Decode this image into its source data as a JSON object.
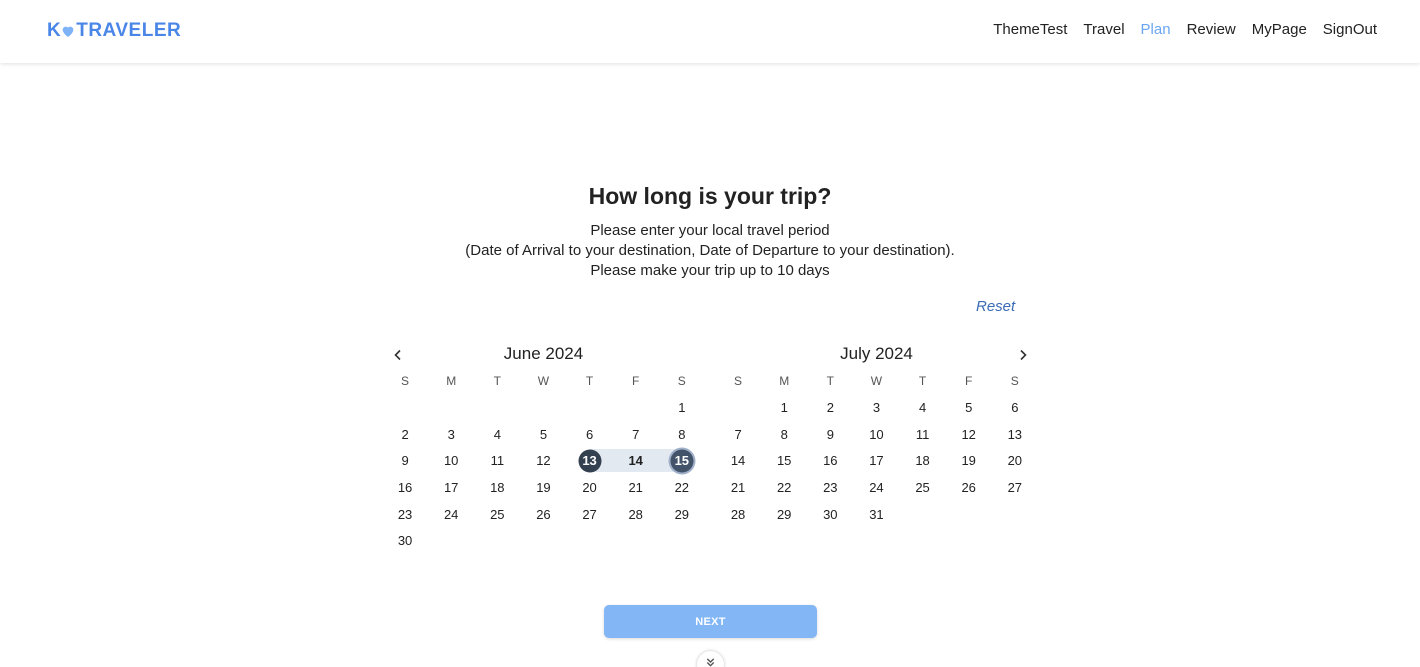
{
  "header": {
    "logo_prefix": "K",
    "logo_text": "TRAVELER",
    "nav": [
      {
        "label": "ThemeTest",
        "active": false
      },
      {
        "label": "Travel",
        "active": false
      },
      {
        "label": "Plan",
        "active": true
      },
      {
        "label": "Review",
        "active": false
      },
      {
        "label": "MyPage",
        "active": false
      },
      {
        "label": "SignOut",
        "active": false
      }
    ]
  },
  "main": {
    "title": "How long is your trip?",
    "description_lines": [
      "Please enter your local travel period",
      "(Date of Arrival to your destination, Date of Departure to your destination).",
      "Please make your trip up to 10 days"
    ],
    "reset_label": "Reset",
    "next_label": "NEXT"
  },
  "calendar": {
    "weekdays": [
      "S",
      "M",
      "T",
      "W",
      "T",
      "F",
      "S"
    ],
    "selected_start": "2024-06-13",
    "selected_end": "2024-06-15",
    "months": [
      {
        "title": "June 2024",
        "key": "june",
        "weeks": [
          [
            "",
            "",
            "",
            "",
            "",
            "",
            "1"
          ],
          [
            "2",
            "3",
            "4",
            "5",
            "6",
            "7",
            "8"
          ],
          [
            "9",
            "10",
            "11",
            "12",
            "13",
            "14",
            "15"
          ],
          [
            "16",
            "17",
            "18",
            "19",
            "20",
            "21",
            "22"
          ],
          [
            "23",
            "24",
            "25",
            "26",
            "27",
            "28",
            "29"
          ],
          [
            "30",
            "",
            "",
            "",
            "",
            "",
            ""
          ]
        ]
      },
      {
        "title": "July 2024",
        "key": "july",
        "weeks": [
          [
            "",
            "1",
            "2",
            "3",
            "4",
            "5",
            "6"
          ],
          [
            "7",
            "8",
            "9",
            "10",
            "11",
            "12",
            "13"
          ],
          [
            "14",
            "15",
            "16",
            "17",
            "18",
            "19",
            "20"
          ],
          [
            "21",
            "22",
            "23",
            "24",
            "25",
            "26",
            "27"
          ],
          [
            "28",
            "29",
            "30",
            "31",
            "",
            "",
            ""
          ]
        ]
      }
    ]
  },
  "colors": {
    "brand": "#4a86e8",
    "nav_active": "#6aa6f2",
    "range_fill": "#e3e9f1",
    "range_start": "#33404f",
    "next_button": "#82b6f5"
  },
  "icons": {
    "logo_mark": "heart-icon",
    "prev": "chevron-left-icon",
    "next": "chevron-right-icon",
    "scroll": "double-chevron-down-icon"
  }
}
